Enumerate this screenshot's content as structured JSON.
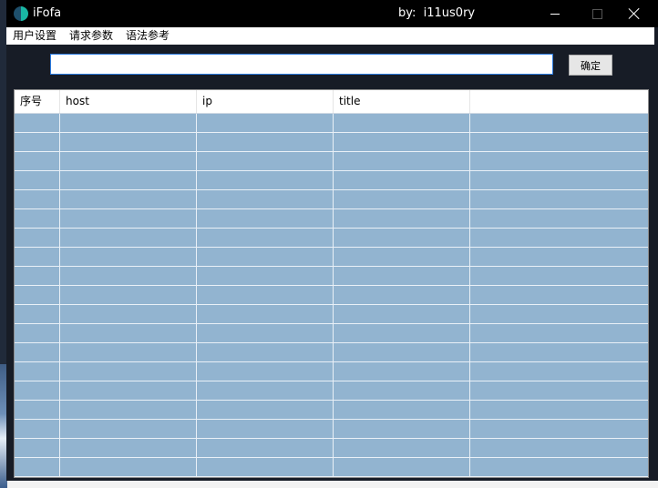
{
  "window": {
    "title": "iFofa",
    "author": "by:  i11us0ry"
  },
  "menu": {
    "items": [
      "用户设置",
      "请求参数",
      "语法参考"
    ]
  },
  "query": {
    "value": "",
    "placeholder": "",
    "confirm_label": "确定"
  },
  "table": {
    "columns": [
      "序号",
      "host",
      "ip",
      "title",
      ""
    ],
    "rows": [
      [
        "",
        "",
        "",
        "",
        ""
      ],
      [
        "",
        "",
        "",
        "",
        ""
      ],
      [
        "",
        "",
        "",
        "",
        ""
      ],
      [
        "",
        "",
        "",
        "",
        ""
      ],
      [
        "",
        "",
        "",
        "",
        ""
      ],
      [
        "",
        "",
        "",
        "",
        ""
      ],
      [
        "",
        "",
        "",
        "",
        ""
      ],
      [
        "",
        "",
        "",
        "",
        ""
      ],
      [
        "",
        "",
        "",
        "",
        ""
      ],
      [
        "",
        "",
        "",
        "",
        ""
      ],
      [
        "",
        "",
        "",
        "",
        ""
      ],
      [
        "",
        "",
        "",
        "",
        ""
      ],
      [
        "",
        "",
        "",
        "",
        ""
      ],
      [
        "",
        "",
        "",
        "",
        ""
      ],
      [
        "",
        "",
        "",
        "",
        ""
      ],
      [
        "",
        "",
        "",
        "",
        ""
      ],
      [
        "",
        "",
        "",
        "",
        ""
      ],
      [
        "",
        "",
        "",
        "",
        ""
      ],
      [
        "",
        "",
        "",
        "",
        ""
      ]
    ]
  },
  "colors": {
    "titlebar": "#000000",
    "table_body": "#92b4d0",
    "input_border": "#2b7be0",
    "window_bg": "#171c26"
  },
  "icons": {
    "app": "ifofa-app-icon",
    "minimize": "minimize-icon",
    "maximize": "maximize-icon",
    "close": "close-icon"
  }
}
